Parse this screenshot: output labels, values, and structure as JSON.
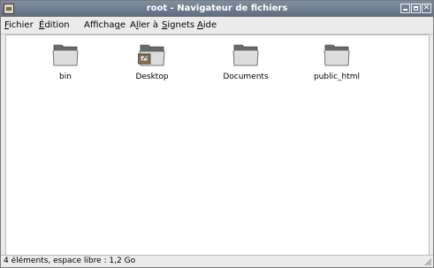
{
  "window": {
    "title": "root - Navigateur de fichiers"
  },
  "menubar": {
    "items": [
      {
        "label": "Fichier",
        "mnemonic": "F"
      },
      {
        "label": "Édition",
        "mnemonic": "É"
      },
      {
        "label": "Affichage",
        "mnemonic": "g"
      },
      {
        "label": "Aller à",
        "mnemonic": "l"
      },
      {
        "label": "Signets",
        "mnemonic": "S"
      },
      {
        "label": "Aide",
        "mnemonic": "A"
      }
    ]
  },
  "files": [
    {
      "name": "bin",
      "icon": "folder-icon"
    },
    {
      "name": "Desktop",
      "icon": "desktop-folder-icon"
    },
    {
      "name": "Documents",
      "icon": "folder-icon"
    },
    {
      "name": "public_html",
      "icon": "folder-icon"
    }
  ],
  "statusbar": {
    "text": "4 éléments, espace libre : 1,2 Go"
  },
  "colors": {
    "titlebar": "#6f7e92",
    "folder_tab": "#6e6e6e",
    "folder_body": "#d9d9d9"
  }
}
